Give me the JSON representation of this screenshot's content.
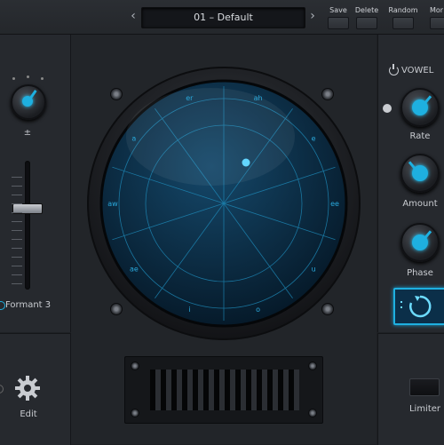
{
  "header": {
    "prev_icon": "chevron-left-icon",
    "next_icon": "chevron-right-icon",
    "preset_name": "01 – Default",
    "buttons": {
      "save": "Save",
      "delete": "Delete",
      "random": "Random",
      "more": "Mor"
    }
  },
  "left": {
    "symbol": "±",
    "formant_label": "Formant 3",
    "edit_label": "Edit",
    "gear_icon": "gear-icon"
  },
  "right": {
    "vowel_label": "VOWEL",
    "rate_label": "Rate",
    "amount_label": "Amount",
    "phase_label": "Phase",
    "limiter_label": "Limiter"
  },
  "pad": {
    "vowels": [
      "er",
      "ah",
      "e",
      "ee",
      "u",
      "o",
      "i",
      "ae",
      "aw",
      "a"
    ]
  },
  "colors": {
    "accent": "#1eb0e0",
    "pad_bg": "#0b2f49"
  }
}
